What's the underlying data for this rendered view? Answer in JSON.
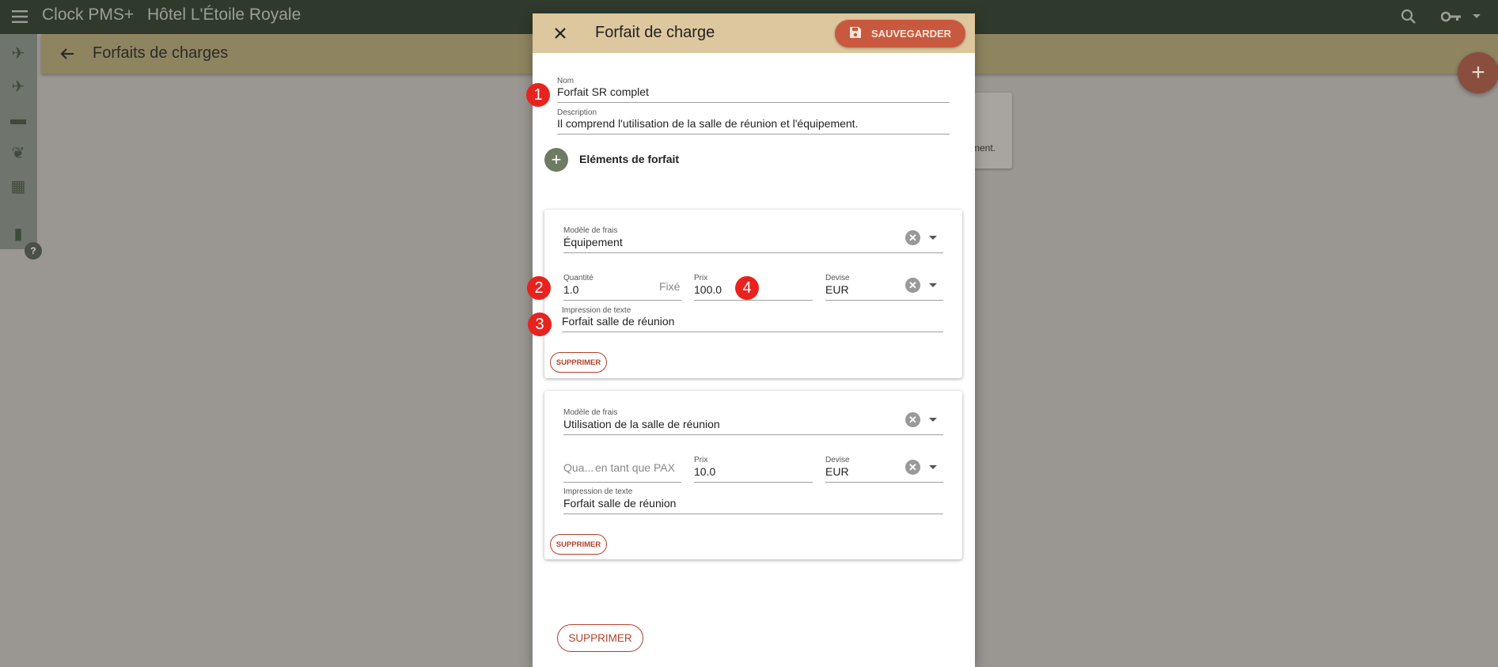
{
  "topbar": {
    "app_title": "Clock PMS+",
    "hotel_name": "Hôtel L'Étoile Royale",
    "icons": [
      "menu-icon",
      "search-icon",
      "key-icon",
      "dropdown-icon"
    ]
  },
  "subbar": {
    "title": "Forfaits de charges"
  },
  "sidebar": {
    "icons": [
      "flight-land-icon",
      "flight-takeoff-icon",
      "bed-icon",
      "leaf-icon",
      "calendar-icon",
      "book-icon",
      "help-icon"
    ]
  },
  "background_card": {
    "text": "ment."
  },
  "fab": {
    "label": "+"
  },
  "dialog": {
    "title": "Forfait de charge",
    "save_label": "SAUVEGARDER",
    "nom": {
      "label": "Nom",
      "value": "Forfait SR complet"
    },
    "description": {
      "label": "Description",
      "value": "Il comprend l'utilisation de la salle de réunion et l'équipement."
    },
    "elements_label": "Eléments de forfait",
    "items": [
      {
        "model_label": "Modèle de frais",
        "model_value": "Équipement",
        "qty_label": "Quantité",
        "qty_value": "1.0",
        "qty_suffix": "Fixé",
        "price_label": "Prix",
        "price_value": "100.0",
        "currency_label": "Devise",
        "currency_value": "EUR",
        "print_label": "Impression de texte",
        "print_value": "Forfait salle de réunion",
        "delete_label": "SUPPRIMER"
      },
      {
        "model_label": "Modèle de frais",
        "model_value": "Utilisation de la salle de réunion",
        "qty_placeholder": "Qua...",
        "qty_suffix": "en tant que PAX",
        "price_label": "Prix",
        "price_value": "10.0",
        "currency_label": "Devise",
        "currency_value": "EUR",
        "print_label": "Impression de texte",
        "print_value": "Forfait salle de réunion",
        "delete_label": "SUPPRIMER"
      }
    ],
    "delete_label": "SUPPRIMER"
  },
  "badges": [
    "1",
    "2",
    "3",
    "4"
  ],
  "colors": {
    "topbar": "#2f3a2c",
    "header": "#ddc79e",
    "accent": "#c8593f",
    "badge": "#e8231f"
  }
}
